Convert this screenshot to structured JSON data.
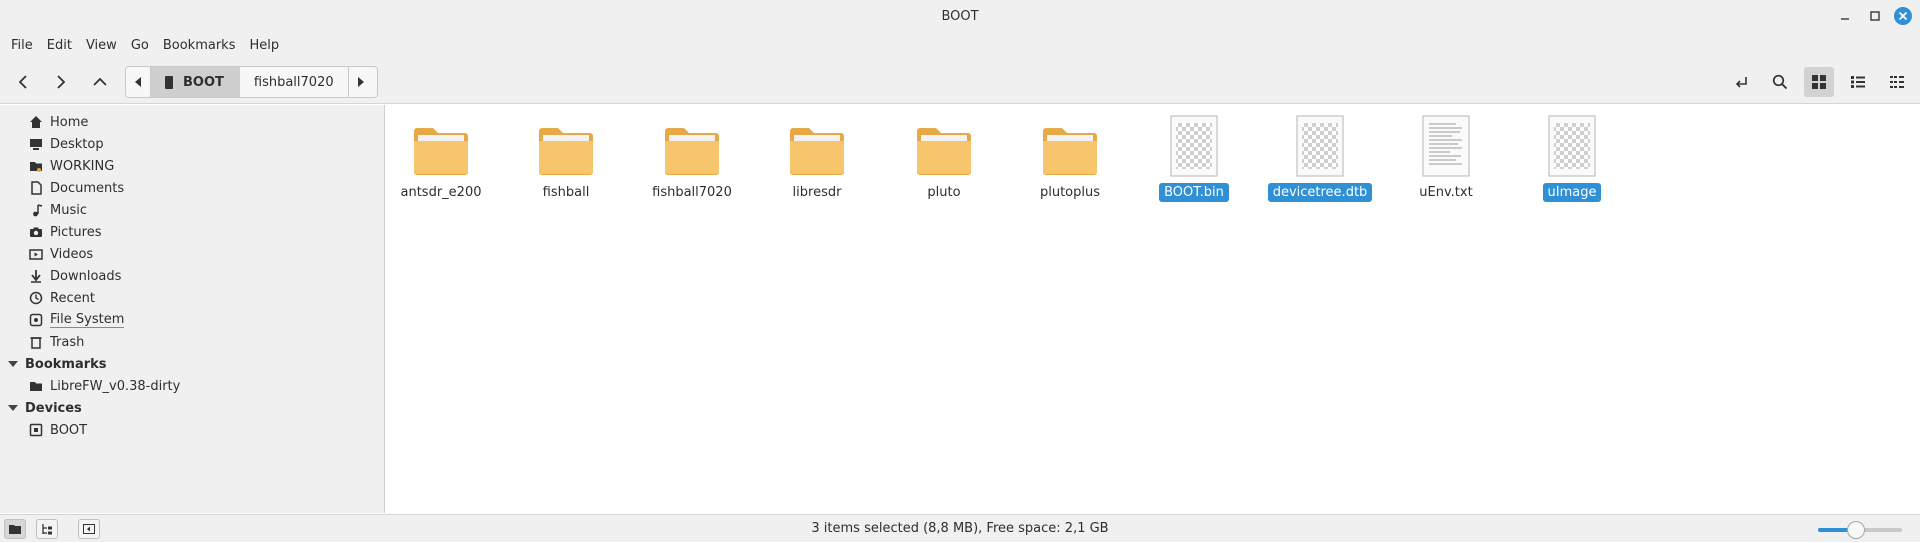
{
  "window": {
    "title": "BOOT"
  },
  "menu": {
    "items": [
      "File",
      "Edit",
      "View",
      "Go",
      "Bookmarks",
      "Help"
    ]
  },
  "pathbar": {
    "crumbs": [
      "BOOT",
      "fishball7020"
    ]
  },
  "sidebar": {
    "places": [
      {
        "label": "Home",
        "icon": "home-icon"
      },
      {
        "label": "Desktop",
        "icon": "desktop-icon"
      },
      {
        "label": "WORKING",
        "icon": "folder-icon"
      },
      {
        "label": "Documents",
        "icon": "document-icon"
      },
      {
        "label": "Music",
        "icon": "music-icon"
      },
      {
        "label": "Pictures",
        "icon": "camera-icon"
      },
      {
        "label": "Videos",
        "icon": "video-icon"
      },
      {
        "label": "Downloads",
        "icon": "download-icon"
      },
      {
        "label": "Recent",
        "icon": "clock-icon"
      },
      {
        "label": "File System",
        "icon": "drive-icon"
      },
      {
        "label": "Trash",
        "icon": "trash-icon"
      }
    ],
    "bookmarks_heading": "Bookmarks",
    "bookmarks": [
      {
        "label": "LibreFW_v0.38-dirty",
        "icon": "folder-icon"
      }
    ],
    "devices_heading": "Devices",
    "devices": [
      {
        "label": "BOOT",
        "icon": "drive-icon"
      }
    ]
  },
  "files": [
    {
      "name": "antsdr_e200",
      "type": "folder",
      "selected": false
    },
    {
      "name": "fishball",
      "type": "folder",
      "selected": false
    },
    {
      "name": "fishball7020",
      "type": "folder",
      "selected": false
    },
    {
      "name": "libresdr",
      "type": "folder",
      "selected": false
    },
    {
      "name": "pluto",
      "type": "folder",
      "selected": false
    },
    {
      "name": "plutoplus",
      "type": "folder",
      "selected": false
    },
    {
      "name": "BOOT.bin",
      "type": "binary",
      "selected": true
    },
    {
      "name": "devicetree.dtb",
      "type": "binary",
      "selected": true
    },
    {
      "name": "uEnv.txt",
      "type": "text",
      "selected": false
    },
    {
      "name": "uImage",
      "type": "binary",
      "selected": true
    }
  ],
  "status": {
    "text": "3 items selected (8,8 MB), Free space: 2,1 GB",
    "zoom_level": 0.45
  },
  "colors": {
    "accent": "#2f90d6",
    "folder": "#f7c56b",
    "folder_dark": "#e6a946",
    "chrome": "#f0f0f0"
  }
}
